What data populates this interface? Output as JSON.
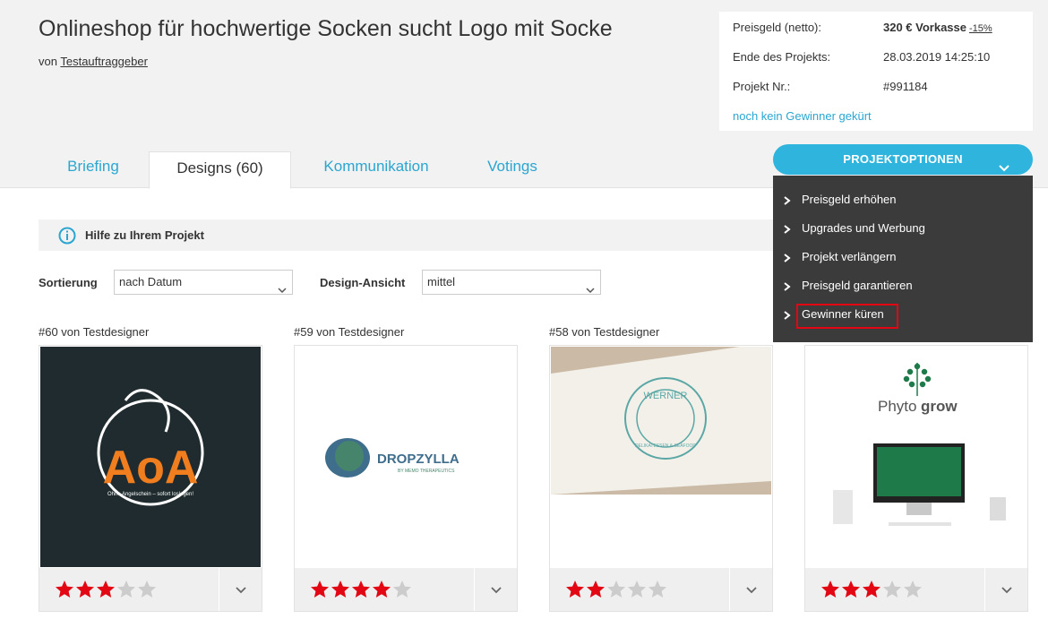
{
  "header": {
    "title": "Onlineshop für hochwertige Socken sucht Logo mit Socke",
    "by_prefix": "von",
    "client": "Testauftraggeber"
  },
  "info": {
    "prize_label": "Preisgeld (netto):",
    "prize_value": "320 € Vorkasse",
    "prize_discount": "-15%",
    "end_label": "Ende des Projekts:",
    "end_value": "28.03.2019 14:25:10",
    "nr_label": "Projekt Nr.:",
    "nr_value": "#991184",
    "winner_status": "noch kein Gewinner gekürt"
  },
  "tabs": [
    {
      "label": "Briefing"
    },
    {
      "label": "Designs (60)"
    },
    {
      "label": "Kommunikation"
    },
    {
      "label": "Votings"
    }
  ],
  "project_options": {
    "button_label": "PROJEKTOPTIONEN",
    "items": [
      {
        "label": "Preisgeld erhöhen"
      },
      {
        "label": "Upgrades und Werbung"
      },
      {
        "label": "Projekt verlängern"
      },
      {
        "label": "Preisgeld garantieren"
      },
      {
        "label": "Gewinner küren"
      }
    ]
  },
  "help": {
    "label": "Hilfe zu Ihrem Projekt"
  },
  "controls": {
    "sort_label": "Sortierung",
    "sort_value": "nach Datum",
    "view_label": "Design-Ansicht",
    "view_value": "mittel"
  },
  "designs": [
    {
      "caption": "#60 von Testdesigner",
      "rating": 3,
      "logo_text": "AoA",
      "logo_sub": "Ohne Angelschein – sofort loslegen!"
    },
    {
      "caption": "#59 von Testdesigner",
      "rating": 4,
      "logo_text": "DROPZYLLA",
      "logo_sub": "BY MEMO THERAPEUTICS"
    },
    {
      "caption": "#58 von Testdesigner",
      "rating": 2,
      "logo_text": "WERNER",
      "logo_sub": "DELIKATESSEN & SEAFOOD"
    },
    {
      "caption": "",
      "rating": 3,
      "logo_text_a": "Phyto",
      "logo_text_b": "grow"
    }
  ],
  "colors": {
    "accent": "#2aa6d1",
    "star_active": "#e30613",
    "star_inactive": "#cccccc",
    "menu_bg": "#3b3b3b"
  }
}
